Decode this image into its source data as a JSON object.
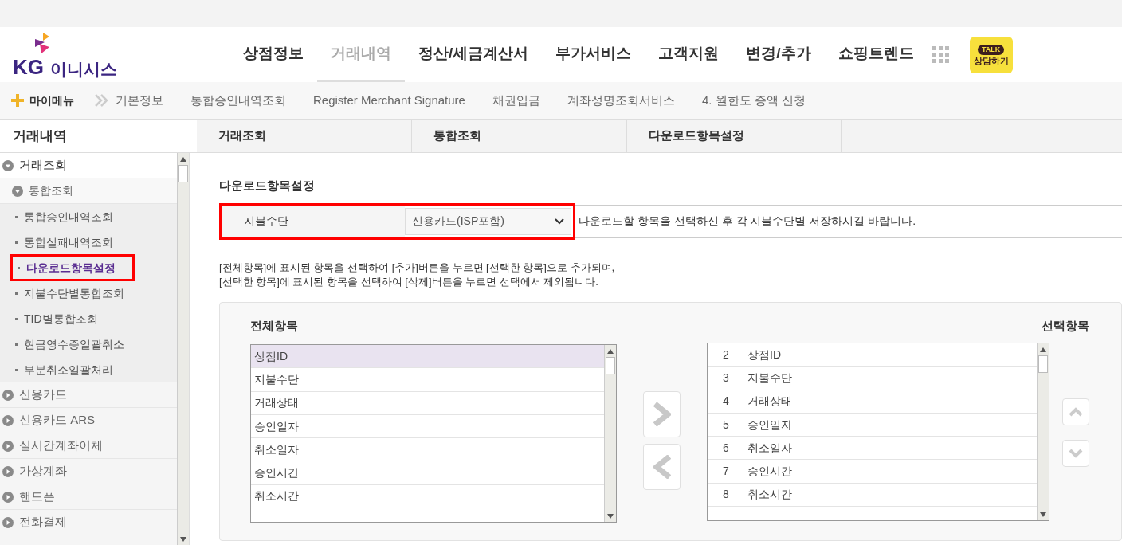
{
  "header": {
    "logo": {
      "mark": "KG",
      "name": "이니시스"
    },
    "nav": [
      {
        "label": "상점정보",
        "selected": false
      },
      {
        "label": "거래내역",
        "selected": true
      },
      {
        "label": "정산/세금계산서",
        "selected": false
      },
      {
        "label": "부가서비스",
        "selected": false
      },
      {
        "label": "고객지원",
        "selected": false
      },
      {
        "label": "변경/추가",
        "selected": false
      },
      {
        "label": "쇼핑트렌드",
        "selected": false
      }
    ],
    "chat_button": {
      "badge": "TALK",
      "label": "상담하기"
    }
  },
  "sub_nav": {
    "my_menu": "마이메뉴",
    "items": [
      "기본정보",
      "통합승인내역조회",
      "Register Merchant Signature",
      "채권입금",
      "계좌성명조회서비스",
      "4. 월한도 증액 신청"
    ]
  },
  "breadcrumb": {
    "section": "거래내역",
    "steps": [
      "거래조회",
      "통합조회",
      "다운로드항목설정"
    ]
  },
  "sidebar": {
    "items": [
      {
        "label": "거래조회",
        "expanded": true,
        "children": [
          {
            "label": "통합조회",
            "expanded": true,
            "children": [
              {
                "label": "통합승인내역조회",
                "selected": false,
                "highlighted": false
              },
              {
                "label": "통합실패내역조회",
                "selected": false,
                "highlighted": false
              },
              {
                "label": "다운로드항목설정",
                "selected": true,
                "highlighted": true
              },
              {
                "label": "지불수단별통합조회",
                "selected": false,
                "highlighted": false
              },
              {
                "label": "TID별통합조회",
                "selected": false,
                "highlighted": false
              },
              {
                "label": "현금영수증일괄취소",
                "selected": false,
                "highlighted": false
              },
              {
                "label": "부분취소일괄처리",
                "selected": false,
                "highlighted": false
              }
            ]
          }
        ]
      },
      {
        "label": "신용카드",
        "expanded": false
      },
      {
        "label": "신용카드 ARS",
        "expanded": false
      },
      {
        "label": "실시간계좌이체",
        "expanded": false
      },
      {
        "label": "가상계좌",
        "expanded": false
      },
      {
        "label": "핸드폰",
        "expanded": false
      },
      {
        "label": "전화결제",
        "expanded": false
      }
    ]
  },
  "content": {
    "title": "다운로드항목설정",
    "filter": {
      "label": "지불수단",
      "value": "신용카드(ISP포함)",
      "highlighted": true,
      "hint": "다운로드할 항목을 선택하신 후 각 지불수단별 저장하시길 바랍니다."
    },
    "instructions": [
      "[전체항목]에 표시된 항목을 선택하여 [추가]버튼을 누르면 [선택한 항목]으로 추가되며,",
      "[선택한 항목]에 표시된 항목을 선택하여 [삭제]버튼을 누르면 선택에서 제외됩니다."
    ],
    "all_items": {
      "title": "전체항목",
      "items": [
        {
          "label": "상점ID",
          "selected": true
        },
        {
          "label": "지불수단",
          "selected": false
        },
        {
          "label": "거래상태",
          "selected": false
        },
        {
          "label": "승인일자",
          "selected": false
        },
        {
          "label": "취소일자",
          "selected": false
        },
        {
          "label": "승인시간",
          "selected": false
        },
        {
          "label": "취소시간",
          "selected": false
        }
      ]
    },
    "selected_items": {
      "title": "선택항목",
      "items": [
        {
          "no": "2",
          "label": "상점ID"
        },
        {
          "no": "3",
          "label": "지불수단"
        },
        {
          "no": "4",
          "label": "거래상태"
        },
        {
          "no": "5",
          "label": "승인일자"
        },
        {
          "no": "6",
          "label": "취소일자"
        },
        {
          "no": "7",
          "label": "승인시간"
        },
        {
          "no": "8",
          "label": "취소시간"
        }
      ]
    }
  }
}
